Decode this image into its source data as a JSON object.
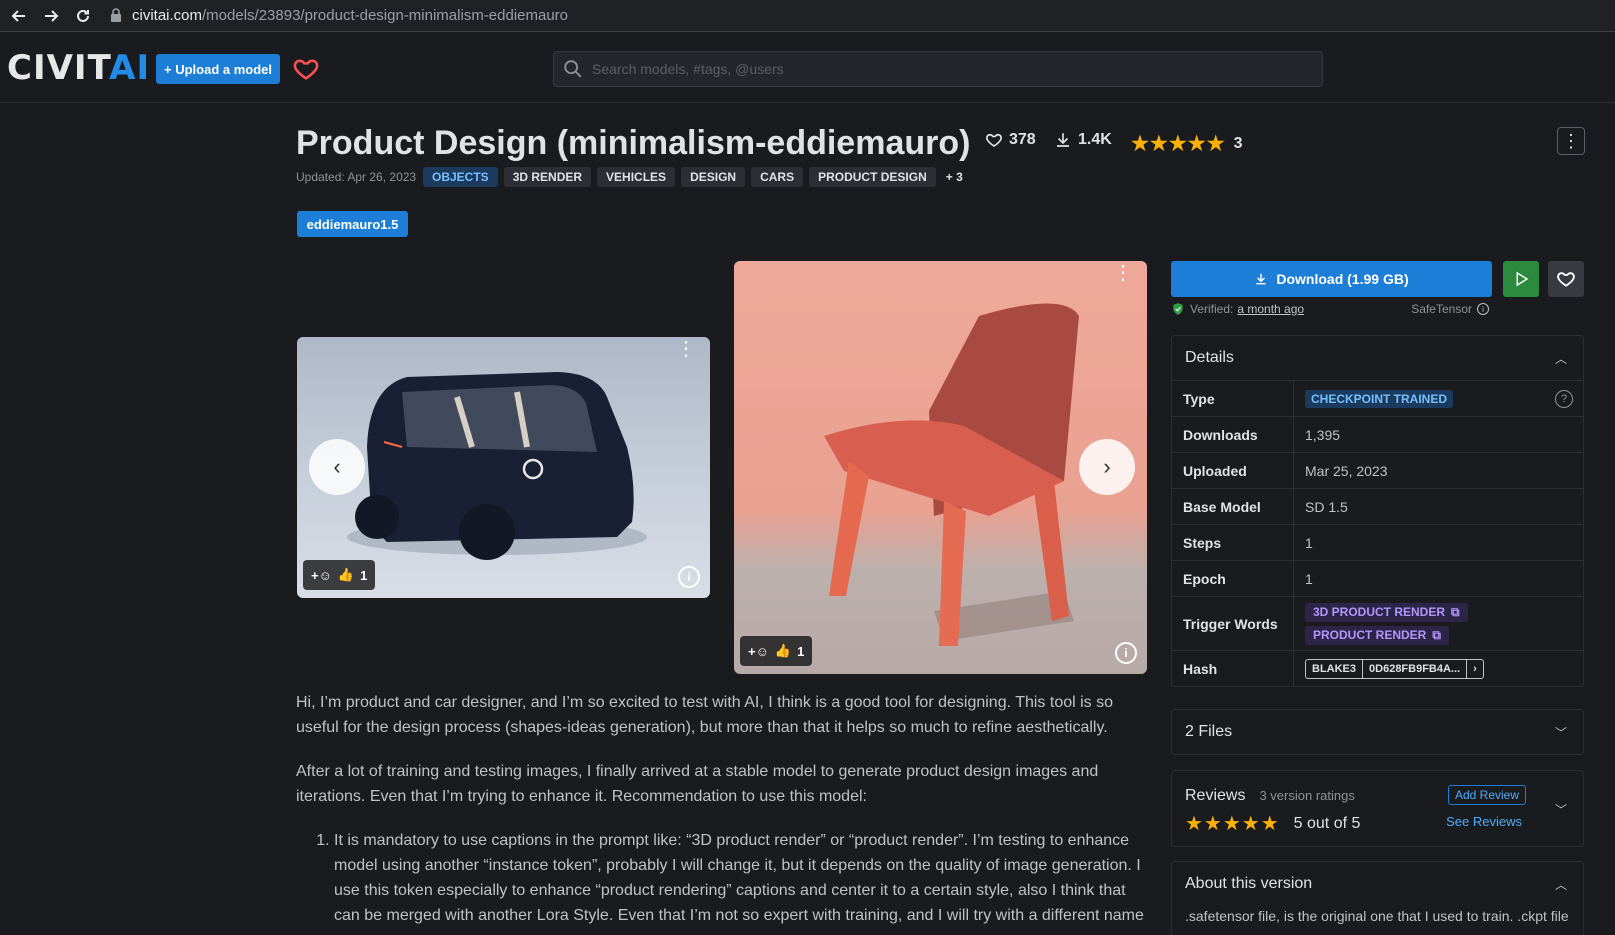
{
  "browser": {
    "url_host": "civitai.com",
    "url_path": "/models/23893/product-design-minimalism-eddiemauro"
  },
  "header": {
    "logo_main": "CIVIT",
    "logo_accent": "AI",
    "upload_label": "+ Upload a model",
    "search_placeholder": "Search models, #tags, @users"
  },
  "model": {
    "title": "Product Design (minimalism-eddiemauro)",
    "likes": "378",
    "downloads_short": "1.4K",
    "rating_count": "3",
    "updated": "Updated: Apr 26, 2023",
    "tags": [
      "OBJECTS",
      "3D RENDER",
      "VEHICLES",
      "DESIGN",
      "CARS",
      "PRODUCT DESIGN"
    ],
    "more_tags": "+ 3",
    "user": "eddiemauro1.5"
  },
  "gallery": {
    "images": [
      {
        "alt": "Minimalist dark blue microcar render",
        "reaction_count": "1"
      },
      {
        "alt": "Coral red minimalist chair render",
        "reaction_count": "1"
      }
    ]
  },
  "description": {
    "p1": "Hi, I’m product and car designer, and I’m so excited to test with AI, I think is a good tool for designing. This tool is so useful for the design process (shapes-ideas generation), but more than that it helps so much to refine aesthetically.",
    "p2": "After a lot of training and testing images, I finally arrived at a stable model to generate product design images and iterations. Even that I’m trying to enhance it. Recommendation to use this model:",
    "li1": "It is mandatory to use captions in the prompt like: “3D product render” or “product render”. I’m testing to enhance model using another “instance token”, probably I will change it, but it depends on the quality of image generation. I use this token especially to enhance “product rendering” captions and center it to a certain style, also I think that can be merged with another Lora Style. Even that I’m not so expert with training, and I will try with a different name"
  },
  "sidebar": {
    "download_label": "Download (1.99 GB)",
    "verified_label": "Verified:",
    "verified_when": "a month ago",
    "safetensor": "SafeTensor",
    "details_title": "Details",
    "details": {
      "type_label": "Type",
      "type_value": "CHECKPOINT TRAINED",
      "downloads_label": "Downloads",
      "downloads_value": "1,395",
      "uploaded_label": "Uploaded",
      "uploaded_value": "Mar 25, 2023",
      "base_label": "Base Model",
      "base_value": "SD 1.5",
      "steps_label": "Steps",
      "steps_value": "1",
      "epoch_label": "Epoch",
      "epoch_value": "1",
      "trigger_label": "Trigger Words",
      "trigger_1": "3D PRODUCT RENDER",
      "trigger_2": "PRODUCT RENDER",
      "hash_label": "Hash",
      "hash_algo": "BLAKE3",
      "hash_value": "0D628FB9FB4A..."
    },
    "files_title": "2 Files",
    "reviews_title": "Reviews",
    "reviews_sub": "3 version ratings",
    "reviews_score": "5 out of 5",
    "add_review": "Add Review",
    "see_reviews": "See Reviews",
    "about_title": "About this version",
    "about_text": ".safetensor file, is the original one that I used to train. .ckpt file"
  }
}
